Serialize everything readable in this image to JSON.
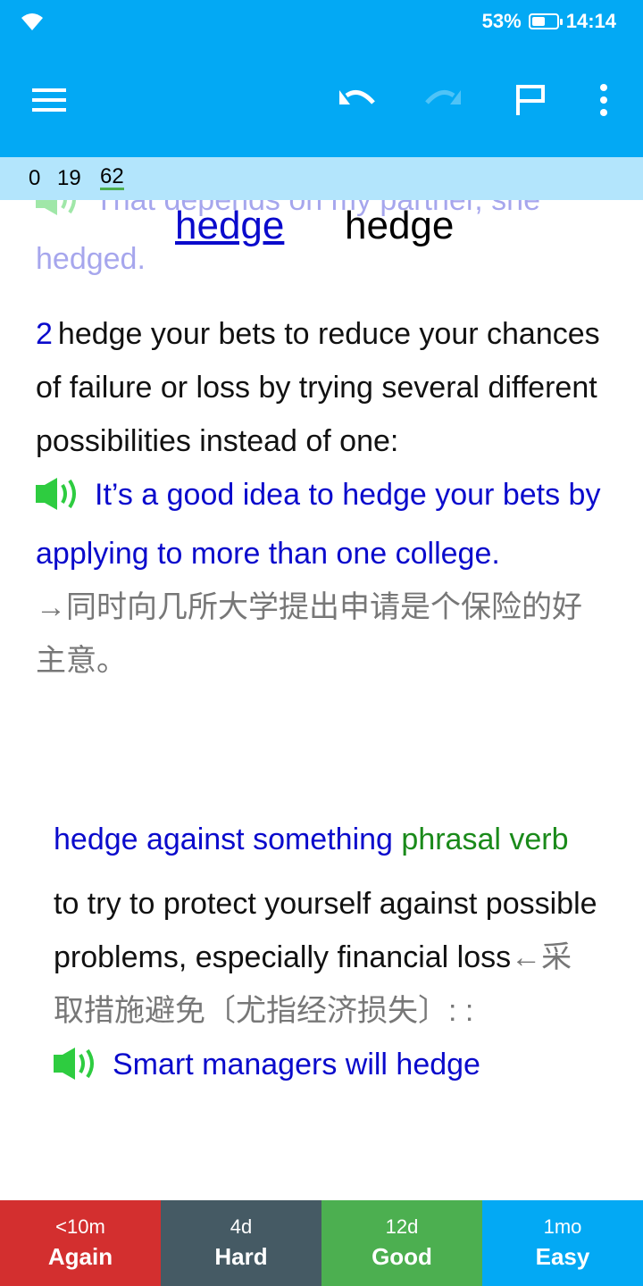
{
  "status_bar": {
    "battery_percent": "53%",
    "time": "14:14",
    "battery_level": 0.53
  },
  "toolbar": {
    "menu_icon": "hamburger-menu-icon",
    "undo_icon": "undo-icon",
    "redo_icon": "redo-icon",
    "flag_icon": "flag-icon",
    "more_icon": "more-vert-icon"
  },
  "counts": {
    "new": "0",
    "learning": "19",
    "review": "62"
  },
  "card": {
    "peek_text": "That depends on my partner, she hedged.",
    "header_front": "hedge",
    "header_back": "hedge",
    "sense2": {
      "number": "2",
      "definition": "hedge your bets to reduce your chances of failure or loss by trying several different possibilities instead of one:",
      "example": "It’s a good idea to hedge your bets by applying to more than one college.",
      "translation": "→同时向几所大学提出申请是个保险的好主意。"
    },
    "phrasal": {
      "headword": "hedge against something",
      "pos": "phrasal verb",
      "definition": "to try to protect yourself against possible problems, especially financial loss",
      "translation": "←采取措施避免〔尤指经济损失〕: :",
      "example": "Smart managers will hedge"
    }
  },
  "answers": [
    {
      "interval": "<10m",
      "label": "Again",
      "color": "#d32f2f"
    },
    {
      "interval": "4d",
      "label": "Hard",
      "color": "#455a64"
    },
    {
      "interval": "12d",
      "label": "Good",
      "color": "#4caf50"
    },
    {
      "interval": "1mo",
      "label": "Easy",
      "color": "#03a9f4"
    }
  ]
}
